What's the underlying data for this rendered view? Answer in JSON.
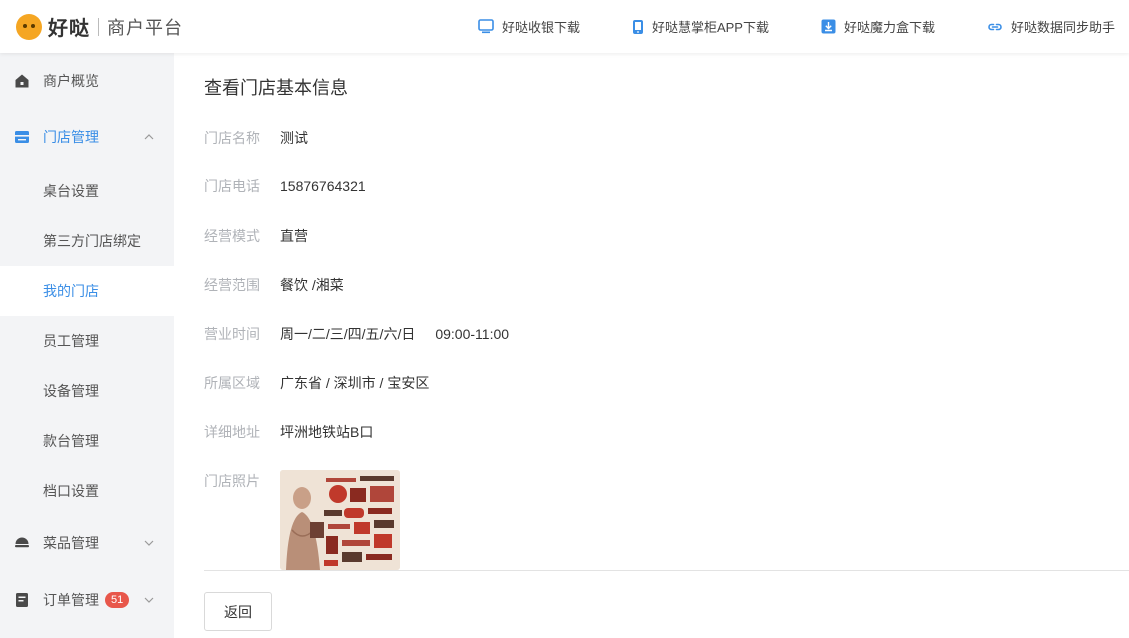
{
  "header": {
    "brand": "好哒",
    "subtitle": "商户平台",
    "links": [
      {
        "label": "好哒收银下载",
        "icon": "monitor-icon"
      },
      {
        "label": "好哒慧掌柜APP下载",
        "icon": "phone-icon"
      },
      {
        "label": "好哒魔力盒下载",
        "icon": "download-icon"
      },
      {
        "label": "好哒数据同步助手",
        "icon": "link-icon"
      }
    ]
  },
  "sidebar": {
    "items": [
      {
        "label": "商户概览",
        "icon": "home-icon"
      },
      {
        "label": "门店管理",
        "icon": "store-icon"
      },
      {
        "label": "桌台设置"
      },
      {
        "label": "第三方门店绑定"
      },
      {
        "label": "我的门店"
      },
      {
        "label": "员工管理"
      },
      {
        "label": "设备管理"
      },
      {
        "label": "款台管理"
      },
      {
        "label": "档口设置"
      },
      {
        "label": "菜品管理",
        "icon": "dish-icon"
      },
      {
        "label": "订单管理",
        "icon": "order-icon",
        "badge": "51"
      }
    ]
  },
  "main": {
    "title": "查看门店基本信息",
    "fields": [
      {
        "key": "门店名称",
        "value": "测试"
      },
      {
        "key": "门店电话",
        "value": "15876764321"
      },
      {
        "key": "经营模式",
        "value": "直营"
      },
      {
        "key": "经营范围",
        "value": "餐饮 /湘菜"
      },
      {
        "key": "营业时间",
        "value": "周一/二/三/四/五/六/日",
        "extra": "09:00-11:00"
      },
      {
        "key": "所属区域",
        "value": "广东省 / 深圳市 / 宝安区"
      },
      {
        "key": "详细地址",
        "value": "坪洲地铁站B口"
      },
      {
        "key": "门店照片"
      }
    ],
    "back_label": "返回"
  },
  "colors": {
    "accent": "#3a8ee6",
    "sidebar_bg": "#f3f4f6",
    "badge": "#e8574b",
    "brand": "#f5a623"
  }
}
